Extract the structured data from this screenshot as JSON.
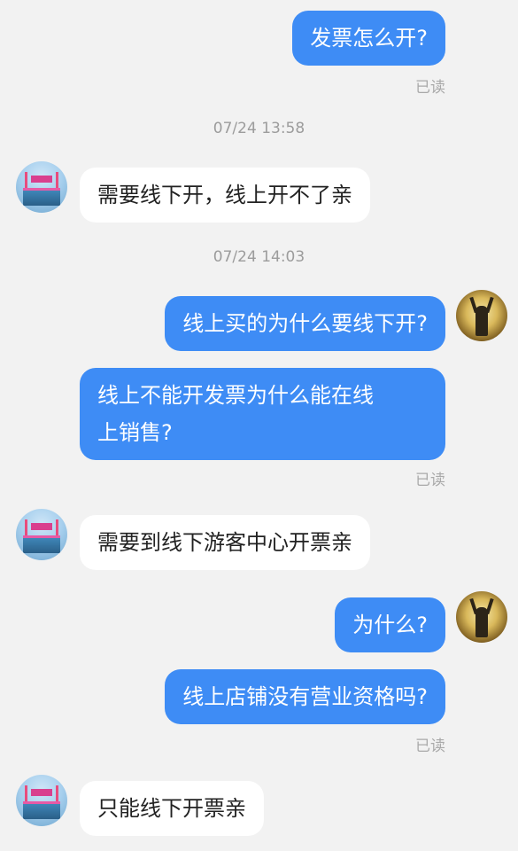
{
  "messages": {
    "m1": "发票怎么开?",
    "m2": "需要线下开，线上开不了亲",
    "m3": "线上买的为什么要线下开?",
    "m4_line1": "线上不能开发票为什么能在线",
    "m4_line2": "上销售?",
    "m5": "需要到线下游客中心开票亲",
    "m6": "为什么?",
    "m7": "线上店铺没有营业资格吗?",
    "m8": "只能线下开票亲"
  },
  "status": {
    "read": "已读"
  },
  "timestamps": {
    "t1": "07/24 13:58",
    "t2": "07/24 14:03"
  },
  "colors": {
    "outgoing_bubble": "#3e8cf5",
    "incoming_bubble": "#ffffff",
    "background": "#f2f2f2"
  },
  "icons": {
    "shop_avatar": "shop-avatar",
    "user_avatar": "user-avatar"
  }
}
